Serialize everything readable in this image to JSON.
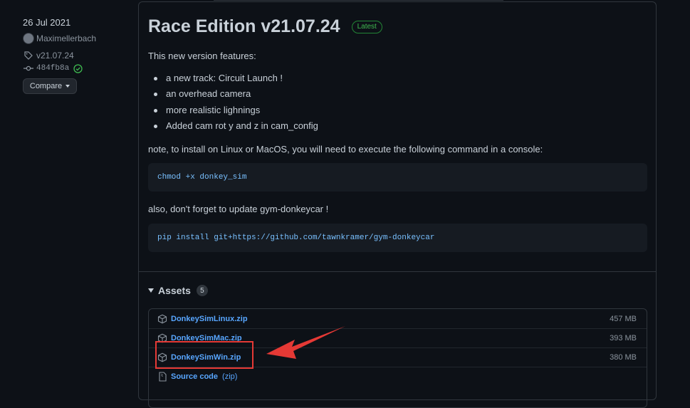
{
  "sidebar": {
    "date": "26 Jul 2021",
    "author": "Maximellerbach",
    "tag": "v21.07.24",
    "commit": "484fb8a",
    "compare_label": "Compare"
  },
  "release": {
    "title": "Race Edition v21.07.24",
    "badge": "Latest",
    "intro": "This new version features:",
    "features": [
      "a new track: Circuit Launch !",
      "an overhead camera",
      "more realistic lighnings",
      "Added cam rot y and z in cam_config"
    ],
    "note": "note, to install on Linux or MacOS, you will need to execute the following command in a console:",
    "code1": "chmod +x donkey_sim",
    "also": "also, don't forget to update gym-donkeycar !",
    "code2": "pip install git+https://github.com/tawnkramer/gym-donkeycar"
  },
  "assets": {
    "title": "Assets",
    "count": "5",
    "items": [
      {
        "name": "DonkeySimLinux.zip",
        "size": "457 MB"
      },
      {
        "name": "DonkeySimMac.zip",
        "size": "393 MB"
      },
      {
        "name": "DonkeySimWin.zip",
        "size": "380 MB"
      },
      {
        "name": "Source code",
        "extra": "(zip)"
      }
    ]
  },
  "colors": {
    "background": "#0d1117",
    "link": "#58a6ff",
    "latest": "#3fb950",
    "annotation": "#e53935"
  }
}
